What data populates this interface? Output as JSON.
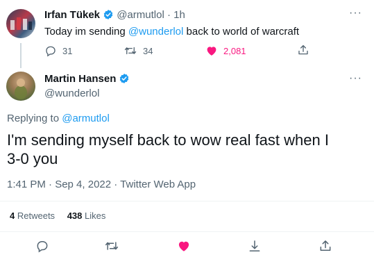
{
  "parent_tweet": {
    "author_name": "Irfan Tükek",
    "handle": "@armutlol",
    "separator": "·",
    "time": "1h",
    "text_before": "Today im sending ",
    "mention": "@wunderlol",
    "text_after": " back to world of warcraft",
    "replies": "31",
    "retweets": "34",
    "likes": "2,081",
    "liked": true
  },
  "main_tweet": {
    "author_name": "Martin Hansen",
    "handle": "@wunderlol",
    "replying_prefix": "Replying to ",
    "replying_to": "@armutlol",
    "text": "I'm sending myself back to wow real fast when I 3-0 you",
    "timestamp": "1:41 PM · Sep 4, 2022 · Twitter Web App",
    "retweets_count": "4",
    "retweets_label": "Retweets",
    "likes_count": "438",
    "likes_label": "Likes",
    "liked": true
  },
  "colors": {
    "accent": "#1d9bf0",
    "like": "#f91880",
    "text": "#0f1419",
    "muted": "#536471"
  },
  "icons": [
    "verified-badge-icon",
    "more-icon",
    "reply-icon",
    "retweet-icon",
    "like-icon",
    "share-icon",
    "bookmark-icon"
  ]
}
